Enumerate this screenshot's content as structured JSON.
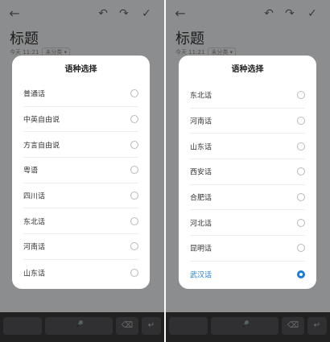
{
  "app": {
    "title": "标题",
    "date": "今天 11:21",
    "category": "未分类"
  },
  "dialog": {
    "title": "语种选择"
  },
  "left_options": [
    {
      "label": "普通话",
      "selected": false
    },
    {
      "label": "中英自由说",
      "selected": false
    },
    {
      "label": "方言自由说",
      "selected": false
    },
    {
      "label": "粤语",
      "selected": false
    },
    {
      "label": "四川话",
      "selected": false
    },
    {
      "label": "东北话",
      "selected": false
    },
    {
      "label": "河南话",
      "selected": false
    },
    {
      "label": "山东话",
      "selected": false
    }
  ],
  "right_options": [
    {
      "label": "东北话",
      "selected": false
    },
    {
      "label": "河南话",
      "selected": false
    },
    {
      "label": "山东话",
      "selected": false
    },
    {
      "label": "西安话",
      "selected": false
    },
    {
      "label": "合肥话",
      "selected": false
    },
    {
      "label": "河北话",
      "selected": false
    },
    {
      "label": "昆明话",
      "selected": false
    },
    {
      "label": "武汉话",
      "selected": true
    }
  ],
  "colors": {
    "accent": "#1a7cd9"
  }
}
